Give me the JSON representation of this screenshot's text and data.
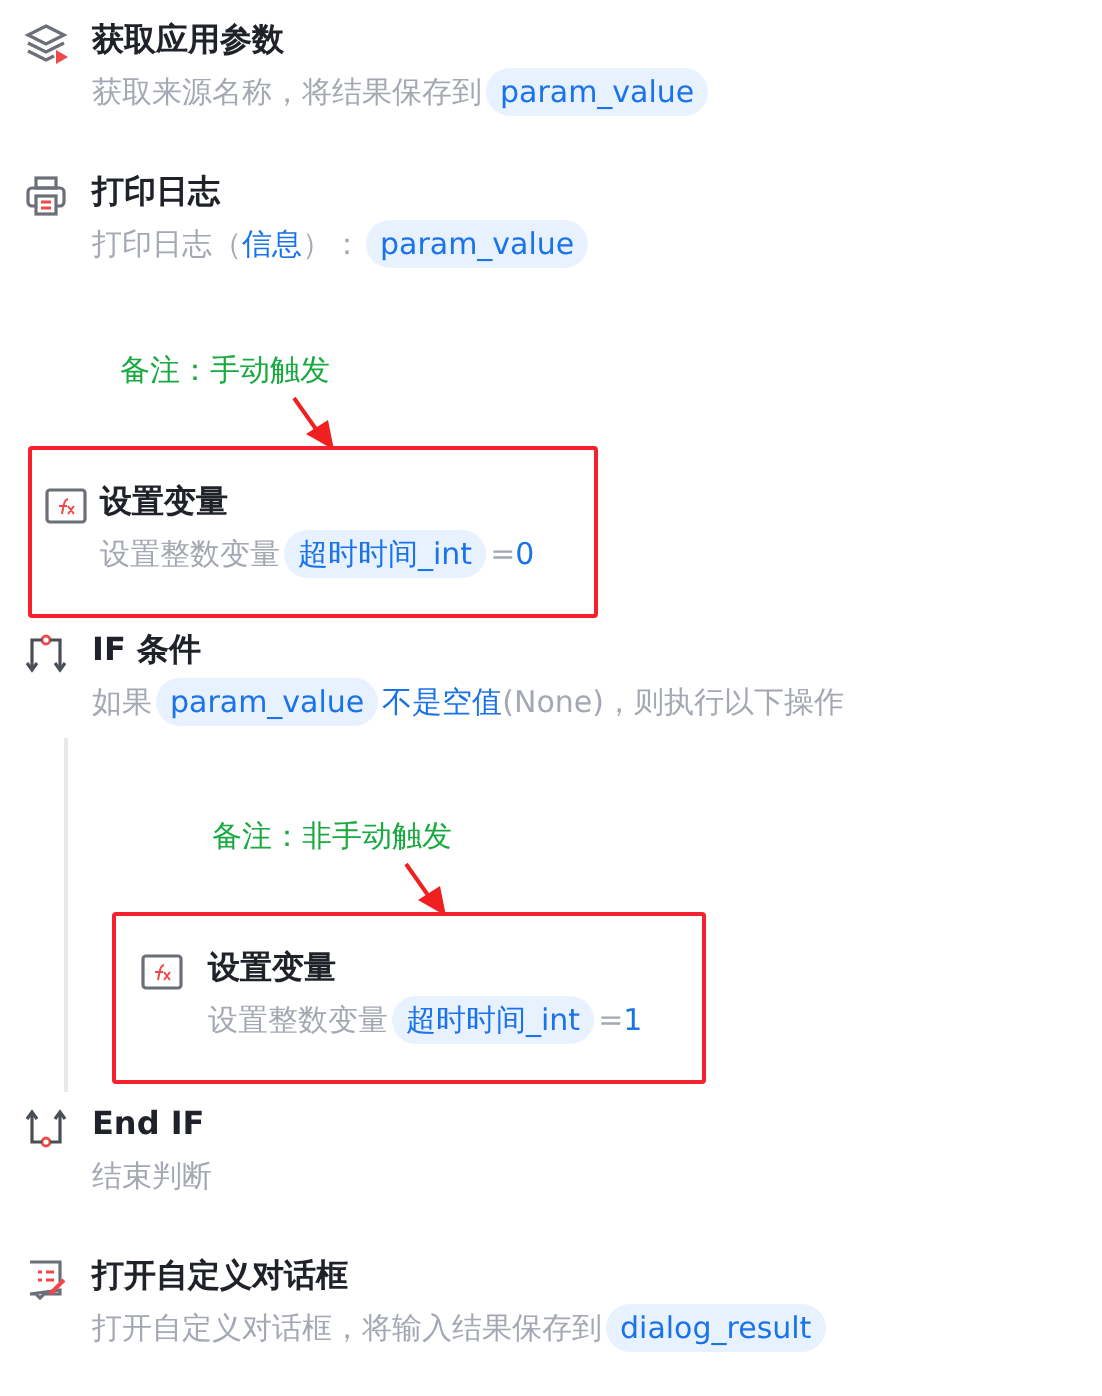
{
  "steps": [
    {
      "kind": "layers",
      "title": "获取应用参数",
      "highlighted": false,
      "description": [
        {
          "kind": "plain",
          "text": "获取来源名称，将结果保存到"
        },
        {
          "kind": "var",
          "text": "param_value"
        }
      ]
    },
    {
      "kind": "printer",
      "title": "打印日志",
      "highlighted": false,
      "description": [
        {
          "kind": "plain",
          "text": "打印日志（"
        },
        {
          "kind": "value",
          "text": "信息"
        },
        {
          "kind": "plain",
          "text": "）："
        },
        {
          "kind": "var",
          "text": "param_value"
        }
      ]
    },
    {
      "kind": "function",
      "title": "设置变量",
      "highlighted": true,
      "note": "备注：手动触发",
      "description": [
        {
          "kind": "plain",
          "text": "设置整数变量"
        },
        {
          "kind": "var",
          "text": "超时时间_int"
        },
        {
          "kind": "plain",
          "text": "="
        },
        {
          "kind": "value",
          "text": "0"
        }
      ]
    },
    {
      "kind": "branch",
      "title": "IF 条件",
      "highlighted": false,
      "description": [
        {
          "kind": "plain",
          "text": "如果"
        },
        {
          "kind": "var",
          "text": "param_value"
        },
        {
          "kind": "value",
          "text": "不是空值"
        },
        {
          "kind": "plain",
          "text": "(None)，则执行以下操作"
        }
      ],
      "children": [
        {
          "kind": "function",
          "title": "设置变量",
          "highlighted": true,
          "note": "备注：非手动触发",
          "description": [
            {
              "kind": "plain",
              "text": "设置整数变量"
            },
            {
              "kind": "var",
              "text": "超时时间_int"
            },
            {
              "kind": "plain",
              "text": "="
            },
            {
              "kind": "value",
              "text": "1"
            }
          ]
        }
      ]
    },
    {
      "kind": "merge",
      "title": "End IF",
      "highlighted": false,
      "description": [
        {
          "kind": "plain",
          "text": "结束判断"
        }
      ]
    },
    {
      "kind": "dialog",
      "title": "打开自定义对话框",
      "highlighted": false,
      "description": [
        {
          "kind": "plain",
          "text": "打开自定义对话框，将输入结果保存到"
        },
        {
          "kind": "var",
          "text": "dialog_result"
        }
      ]
    }
  ]
}
